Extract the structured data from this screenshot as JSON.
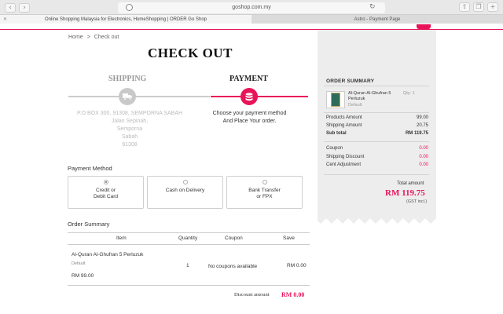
{
  "browser": {
    "url": "goshop.com.my",
    "tabs": [
      {
        "label": "Online Shopping Malaysia for Electronics, HomeShopping | ORDER Go Shop",
        "active": true
      },
      {
        "label": "Astro - Payment Page",
        "active": false
      }
    ],
    "back_icon": "chevron-left-icon",
    "forward_icon": "chevron-right-icon",
    "reload_icon": "reload-icon",
    "share_icon": "share-icon",
    "tabs_icon": "tabs-icon",
    "add_tab_icon": "plus-icon"
  },
  "brand_color": "#e8145a",
  "breadcrumb": {
    "home": "Home",
    "separator": ">",
    "current": "Check out"
  },
  "page_title": "CHECK OUT",
  "steps": {
    "shipping_label": "SHIPPING",
    "payment_label": "PAYMENT",
    "shipping_icon": "truck-icon",
    "payment_icon": "database-icon",
    "shipping_address": [
      "P.O BOX 300, 91308, SEMPORNA SABAH",
      "Jalan Sepinah,",
      "Semporna",
      "Sabah",
      "91308"
    ],
    "payment_text": [
      "Choose your payment method",
      "And Place Your order."
    ]
  },
  "payment_method": {
    "label": "Payment Method",
    "options": [
      {
        "line1": "Credit or",
        "line2": "Debit Card",
        "selected": true
      },
      {
        "line1": "Cash on Delivery",
        "line2": "",
        "selected": false
      },
      {
        "line1": "Bank Transfer",
        "line2": "or FPX",
        "selected": false
      }
    ]
  },
  "order_summary": {
    "label": "Order Summary",
    "headers": {
      "item": "Item",
      "quantity": "Quantity",
      "coupon": "Coupon",
      "save": "Save"
    },
    "row": {
      "name": "Al-Quran Al-Ghufran 5 Perluzuk",
      "variant": "Default",
      "price": "RM 99.00",
      "quantity": "1",
      "coupon": "No coupons available",
      "save": "RM 0.00"
    },
    "discount_label": "Discount amount",
    "discount_value": "RM 0.00"
  },
  "side_summary": {
    "title": "ORDER SUMMARY",
    "product": {
      "name": "Al-Quran Al-Ghufran 5 Perluzuk",
      "variant": "Default",
      "qty": "Qty: 1"
    },
    "rows1": [
      {
        "label": "Products Amount",
        "value": "99.00"
      },
      {
        "label": "Shipping Amount",
        "value": "20.75"
      },
      {
        "label": "Sub total",
        "value": "RM 119.75"
      }
    ],
    "rows2": [
      {
        "label": "Coupon",
        "value": "0.00"
      },
      {
        "label": "Shipping Discount",
        "value": "0.00"
      },
      {
        "label": "Cent Adjustment",
        "value": "0.00"
      }
    ],
    "total_label": "Total amount",
    "total_value": "RM 119.75",
    "gst": "(GST incl.)"
  }
}
